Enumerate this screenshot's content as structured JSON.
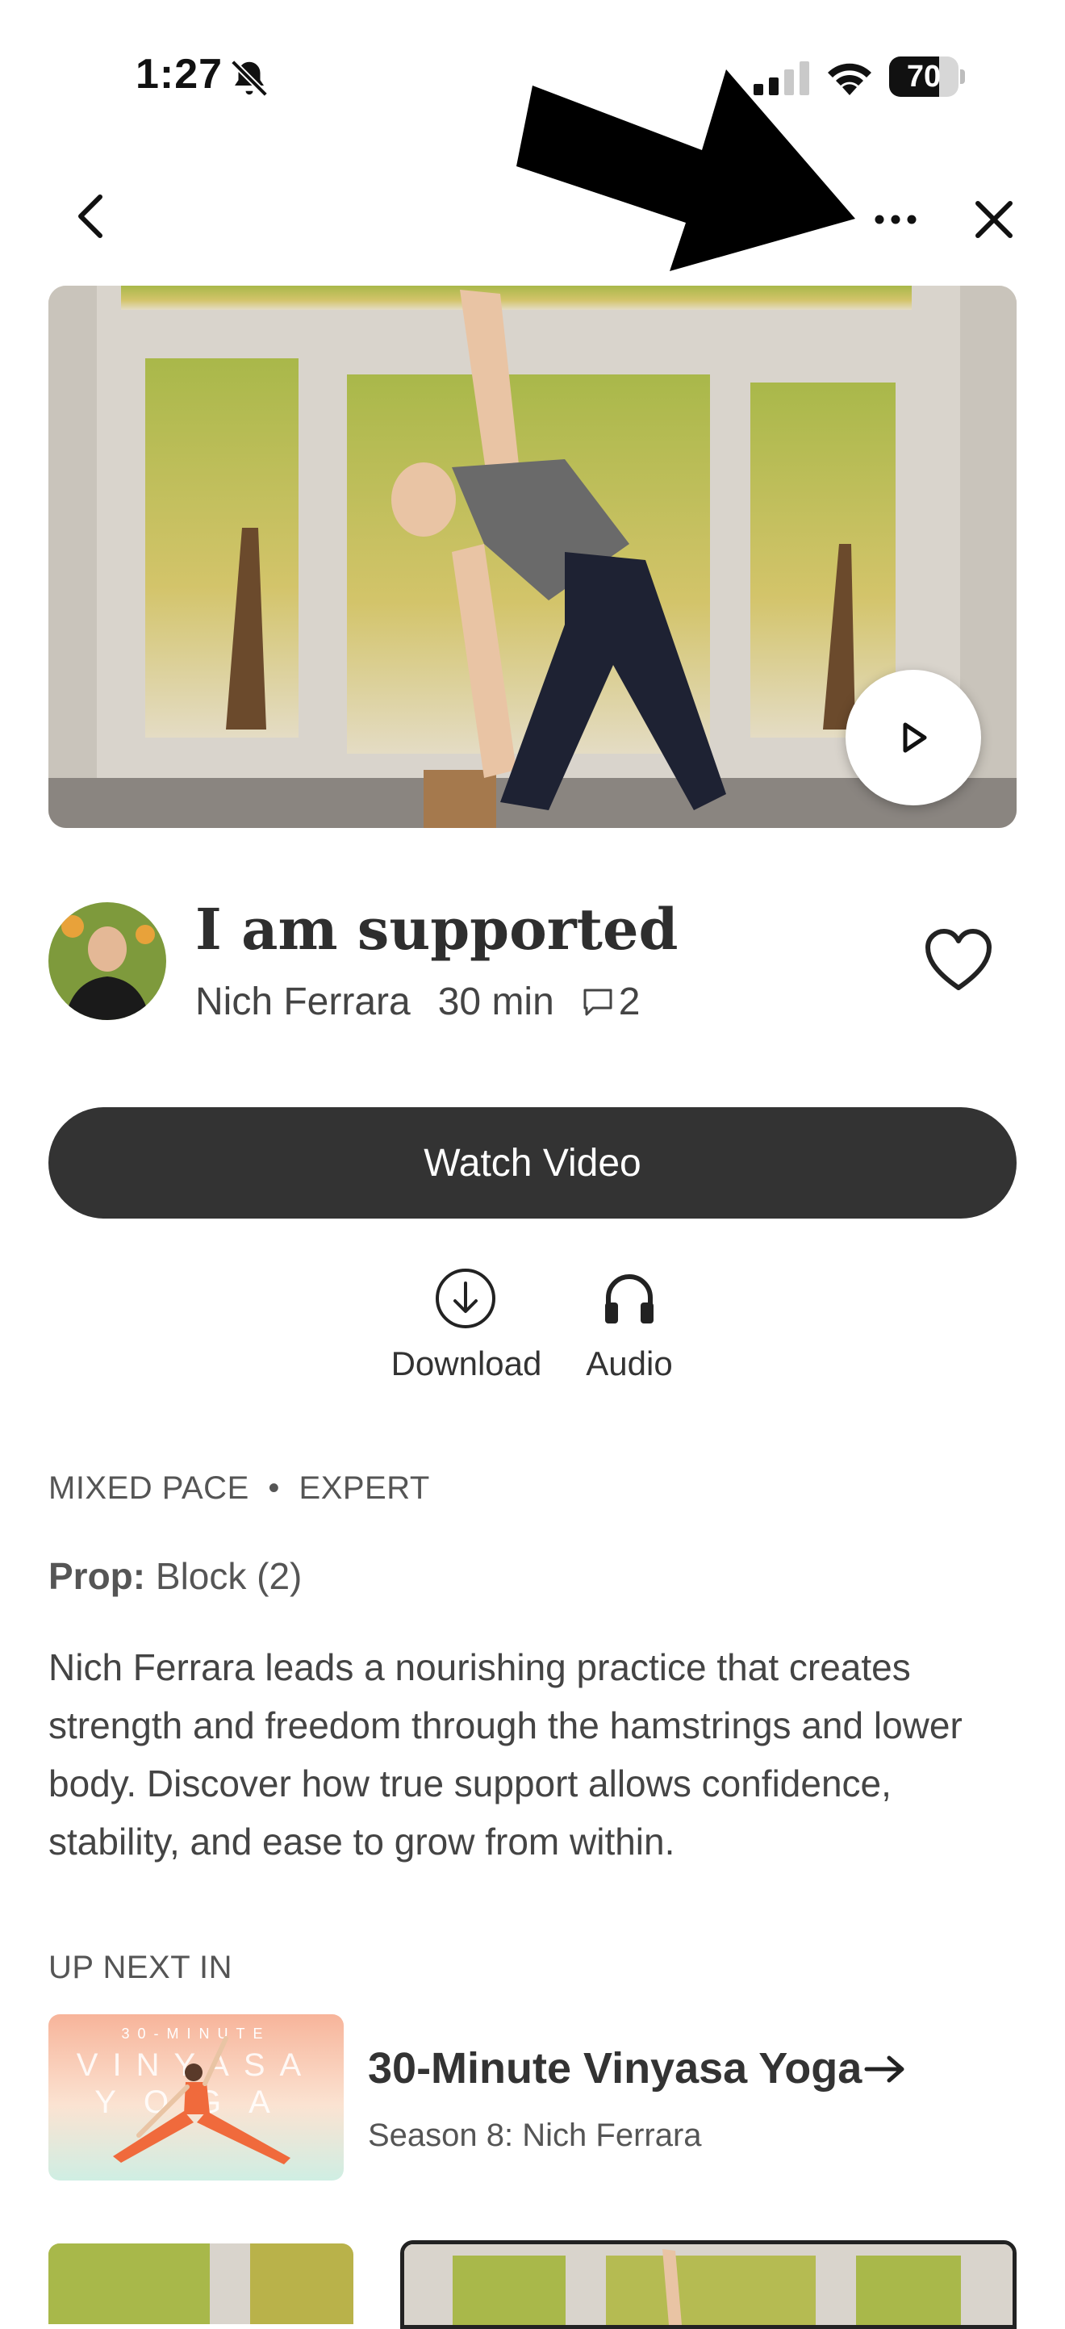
{
  "status_bar": {
    "time": "1:27",
    "battery": "70"
  },
  "video": {
    "title": "I am supported",
    "instructor": "Nich Ferrara",
    "duration": "30 min",
    "comment_count": "2",
    "watch_label": "Watch Video",
    "download_label": "Download",
    "audio_label": "Audio",
    "pace": "MIXED PACE",
    "tag_separator": "•",
    "level": "EXPERT",
    "prop_label": "Prop:",
    "prop_value": "Block (2)",
    "description": "Nich Ferrara leads a nourishing practice that creates strength and freedom through the hamstrings and lower body. Discover how true support allows confidence, stability, and ease to grow from within."
  },
  "up_next": {
    "heading": "UP NEXT IN",
    "series_title": "30-Minute Vinyasa Yoga",
    "series_subtitle": "Season 8: Nich Ferrara",
    "thumb_top_text": "30-MINUTE",
    "thumb_word1": "VINYASA",
    "thumb_word2": "YOGA"
  },
  "colors": {
    "button_dark": "#333333",
    "text_primary": "#333333",
    "text_secondary": "#555555"
  },
  "icons": [
    "back-icon",
    "more-icon",
    "close-icon",
    "play-icon",
    "heart-icon",
    "comment-icon",
    "download-icon",
    "headphones-icon",
    "arrow-right-icon",
    "bell-slash-icon",
    "signal-icon",
    "wifi-icon",
    "battery-icon"
  ]
}
